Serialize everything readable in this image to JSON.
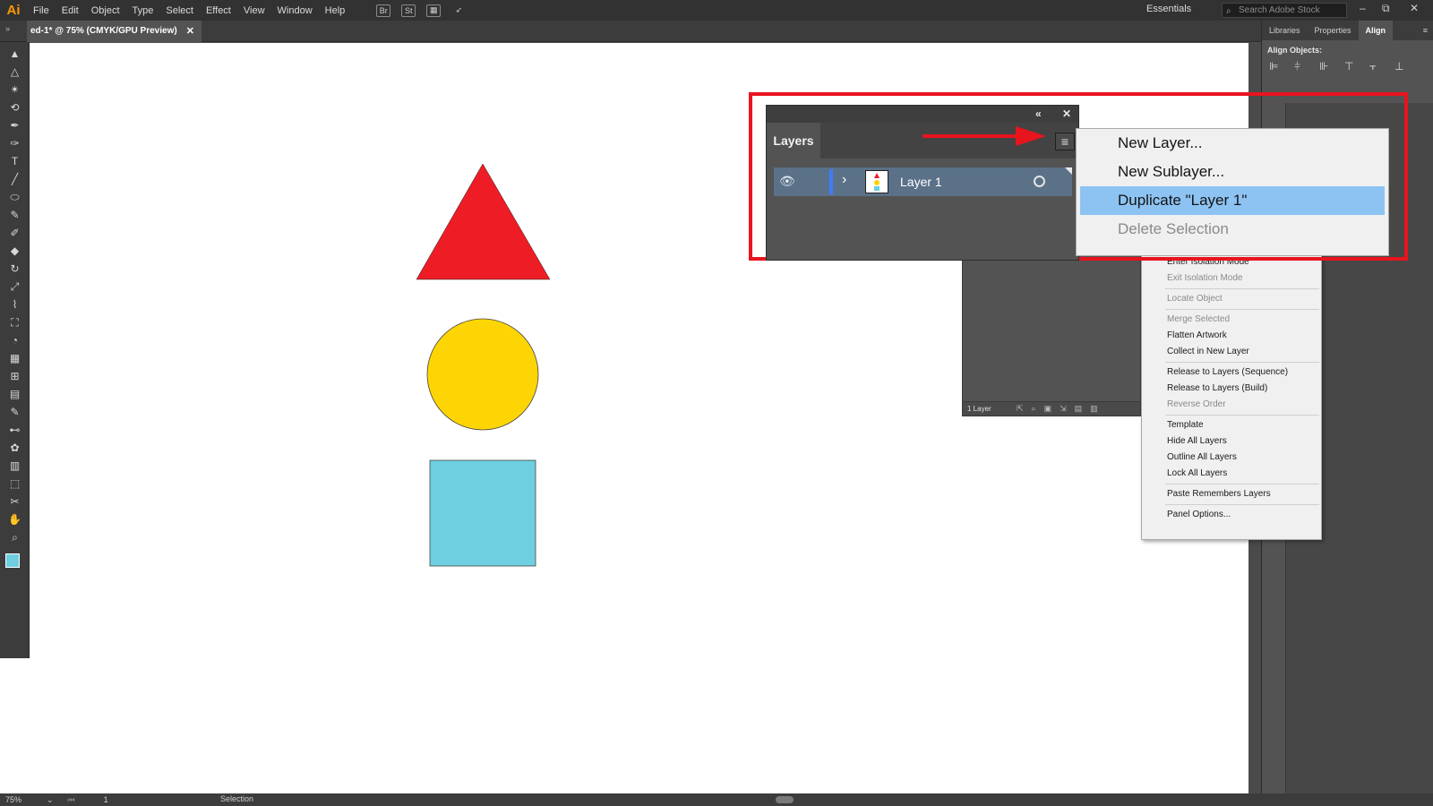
{
  "app": {
    "logo": "Ai",
    "workspace": "Essentials",
    "search_placeholder": "Search Adobe Stock",
    "win_min": "–",
    "win_max": "⧉",
    "win_close": "✕"
  },
  "menu": [
    "File",
    "Edit",
    "Object",
    "Type",
    "Select",
    "Effect",
    "View",
    "Window",
    "Help"
  ],
  "menubar_icons": [
    "Br",
    "St"
  ],
  "document": {
    "tab_title": "ed-1* @ 75% (CMYK/GPU Preview)",
    "tab_close": "✕"
  },
  "colors": {
    "triangle": "#ee1c25",
    "circle": "#fed504",
    "square": "#6dcfdf",
    "highlight": "#8dc3f2",
    "callout": "#e8141e"
  },
  "status": {
    "zoom": "75%",
    "page": "1",
    "tool": "Selection"
  },
  "right_panel": {
    "tabs": [
      "Libraries",
      "Properties",
      "Align"
    ],
    "active_tab": "Align",
    "align_label": "Align Objects:"
  },
  "layers_panel": {
    "tab_label": "Layers",
    "layer_name": "Layer 1",
    "footer_count": "1 Layer"
  },
  "zoomed_menu": [
    {
      "label": "New Layer...",
      "state": "normal"
    },
    {
      "label": "New Sublayer...",
      "state": "normal"
    },
    {
      "label": "Duplicate \"Layer 1\"",
      "state": "highlighted"
    },
    {
      "label": "Delete Selection",
      "state": "disabled"
    }
  ],
  "context_menu": [
    {
      "label": "Enter Isolation Mode",
      "disabled": false
    },
    {
      "label": "Exit Isolation Mode",
      "disabled": true
    },
    {
      "sep": true
    },
    {
      "label": "Locate Object",
      "disabled": true
    },
    {
      "sep": true
    },
    {
      "label": "Merge Selected",
      "disabled": true
    },
    {
      "label": "Flatten Artwork",
      "disabled": false
    },
    {
      "label": "Collect in New Layer",
      "disabled": false
    },
    {
      "sep": true
    },
    {
      "label": "Release to Layers (Sequence)",
      "disabled": false
    },
    {
      "label": "Release to Layers (Build)",
      "disabled": false
    },
    {
      "label": "Reverse Order",
      "disabled": true
    },
    {
      "sep": true
    },
    {
      "label": "Template",
      "disabled": false
    },
    {
      "label": "Hide All Layers",
      "disabled": false
    },
    {
      "label": "Outline All Layers",
      "disabled": false
    },
    {
      "label": "Lock All Layers",
      "disabled": false
    },
    {
      "sep": true
    },
    {
      "label": "Paste Remembers Layers",
      "disabled": false
    },
    {
      "sep": true
    },
    {
      "label": "Panel Options...",
      "disabled": false
    }
  ],
  "tools": [
    "selection-tool",
    "direct-selection-tool",
    "magic-wand-tool",
    "lasso-tool",
    "pen-tool",
    "curvature-tool",
    "type-tool",
    "line-tool",
    "rectangle-tool",
    "paintbrush-tool",
    "shaper-tool",
    "eraser-tool",
    "rotate-tool",
    "scale-tool",
    "warp-tool",
    "free-transform-tool",
    "shape-builder-tool",
    "perspective-grid-tool",
    "mesh-tool",
    "gradient-tool",
    "eyedropper-tool",
    "blend-tool",
    "symbol-sprayer-tool",
    "column-graph-tool",
    "artboard-tool",
    "slice-tool",
    "hand-tool",
    "zoom-tool"
  ]
}
